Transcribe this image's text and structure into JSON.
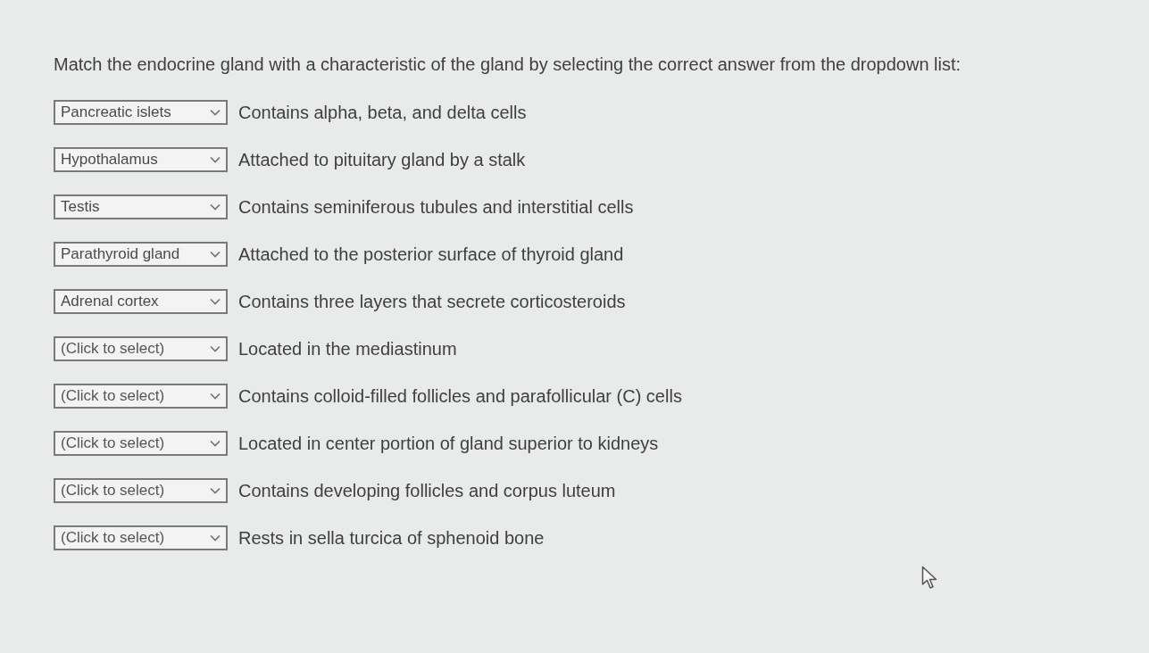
{
  "question": {
    "prompt": "Match the endocrine gland with a characteristic of the gland by selecting the correct answer from the dropdown list:"
  },
  "items": [
    {
      "value": "Pancreatic islets",
      "description": "Contains alpha, beta, and delta cells"
    },
    {
      "value": "Hypothalamus",
      "description": "Attached to pituitary gland by a stalk"
    },
    {
      "value": "Testis",
      "description": "Contains seminiferous tubules and interstitial cells"
    },
    {
      "value": "Parathyroid gland",
      "description": "Attached to the posterior surface of thyroid gland"
    },
    {
      "value": "Adrenal cortex",
      "description": "Contains three layers that secrete corticosteroids"
    },
    {
      "placeholder": "(Click to select)",
      "description": "Located in the mediastinum"
    },
    {
      "placeholder": "(Click to select)",
      "description": "Contains colloid-filled follicles and parafollicular (C) cells"
    },
    {
      "placeholder": "(Click to select)",
      "description": "Located in center portion of gland superior to kidneys"
    },
    {
      "placeholder": "(Click to select)",
      "description": "Contains developing follicles and corpus luteum"
    },
    {
      "placeholder": "(Click to select)",
      "description": "Rests in sella turcica of sphenoid bone"
    }
  ]
}
